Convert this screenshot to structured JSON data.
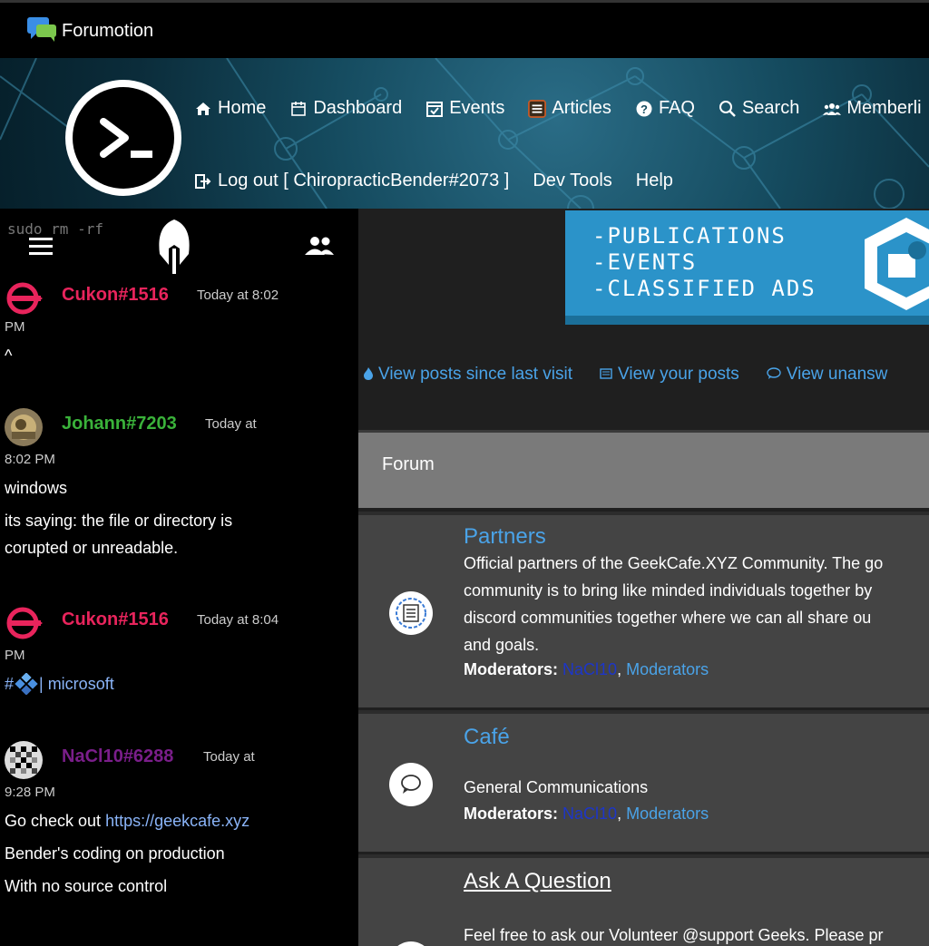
{
  "topbar": {
    "brand": "Forumotion"
  },
  "nav": {
    "row1": [
      {
        "label": "Home",
        "icon": "home-icon"
      },
      {
        "label": "Dashboard",
        "icon": "calendar-icon"
      },
      {
        "label": "Events",
        "icon": "calendar-check-icon"
      },
      {
        "label": "Articles",
        "icon": "articles-icon"
      },
      {
        "label": "FAQ",
        "icon": "help-icon"
      },
      {
        "label": "Search",
        "icon": "search-icon"
      },
      {
        "label": "Memberli",
        "icon": "members-icon"
      }
    ],
    "row2": [
      {
        "label": "Log out [ ChiropracticBender#2073 ]",
        "icon": "logout-icon"
      },
      {
        "label": "Dev Tools"
      },
      {
        "label": "Help"
      }
    ]
  },
  "sidebar": {
    "header_text": "sudo rm -rf",
    "messages": [
      {
        "user": "Cukon#1516",
        "color": "#e8245c",
        "time_a": "Today at 8:02",
        "time_b": "PM",
        "lines": [
          "^"
        ]
      },
      {
        "user": "Johann#7203",
        "color": "#3ab23a",
        "time_a": "Today at",
        "time_b": "8:02 PM",
        "lines": [
          "windows",
          "its saying: the file or directory is",
          "corupted or unreadable."
        ]
      },
      {
        "user": "Cukon#1516",
        "color": "#e8245c",
        "time_a": "Today at 8:04",
        "time_b": "PM",
        "lines": [
          "#",
          " | microsoft"
        ]
      },
      {
        "user": "NaCl10#6288",
        "color": "#7a1e8a",
        "time_a": "Today at",
        "time_b": "9:28 PM",
        "lines": [
          "Go check out ",
          "https://geekcafe.xyz",
          "Bender's coding on production",
          "With no source control"
        ]
      }
    ]
  },
  "banner": {
    "lines": [
      "-PUBLICATIONS",
      "-EVENTS",
      "-CLASSIFIED ADS"
    ]
  },
  "quick_links": [
    {
      "label": "View posts since last visit",
      "icon": "flame-icon"
    },
    {
      "label": "View your posts",
      "icon": "posts-icon"
    },
    {
      "label": "View unansw",
      "icon": "speech-icon"
    }
  ],
  "forum": {
    "header": "Forum",
    "rows": [
      {
        "title": "Partners",
        "desc": [
          "Official partners of the GeekCafe.XYZ Community. The go",
          "community is to bring like minded individuals together by",
          "discord communities together where we can all share ou",
          "and goals."
        ],
        "mods_label": "Moderators:",
        "mod1": "NaCl10",
        "sep": ", ",
        "mod2": "Moderators"
      },
      {
        "title": "Café",
        "desc": [
          "General Communications"
        ],
        "mods_label": "Moderators:",
        "mod1": "NaCl10",
        "sep": ", ",
        "mod2": "Moderators"
      },
      {
        "title": "Ask A Question",
        "desc": [
          "Feel free to ask our Volunteer @support Geeks. Please pr"
        ]
      }
    ]
  }
}
